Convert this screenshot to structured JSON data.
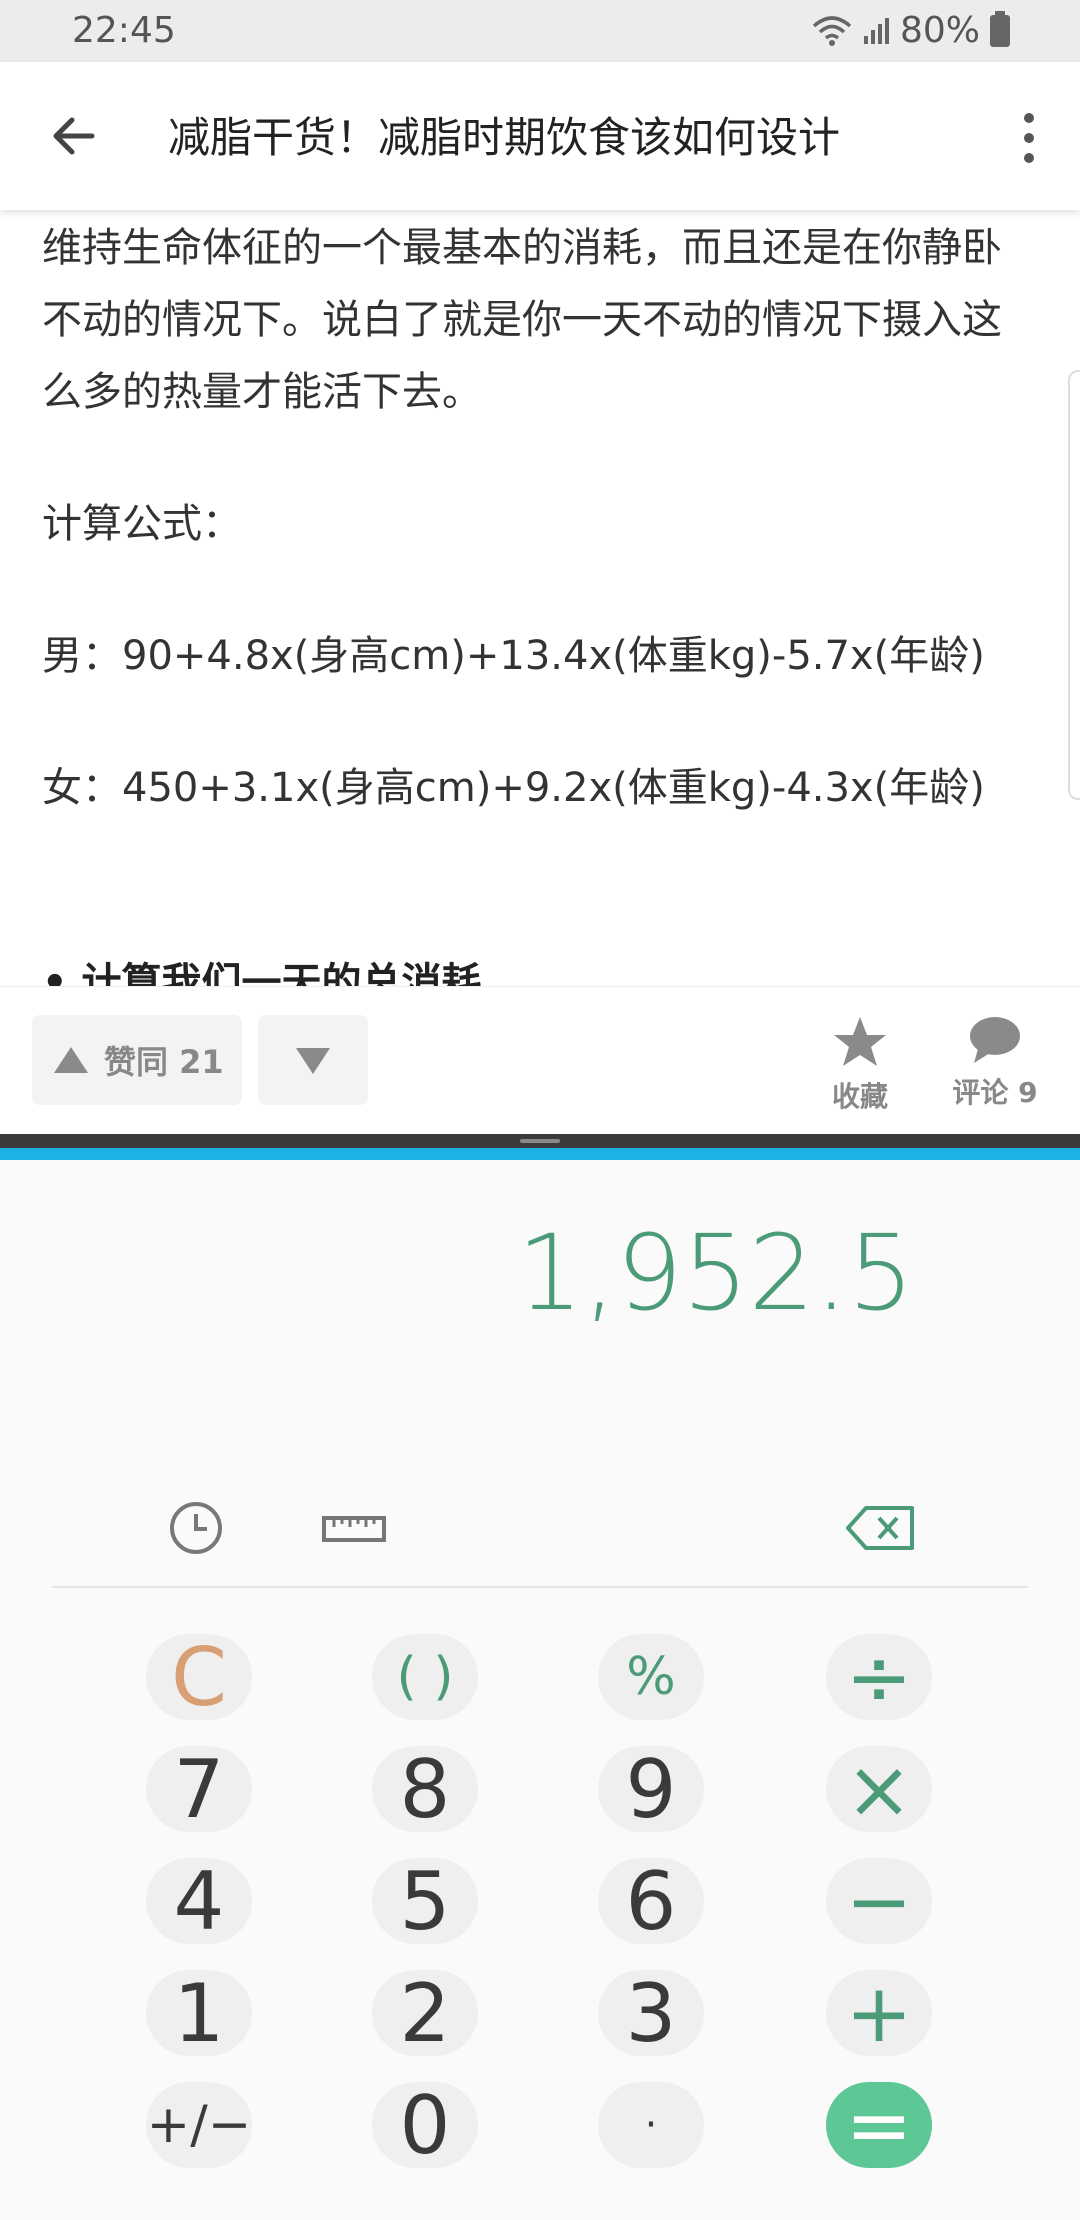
{
  "status": {
    "time": "22:45",
    "battery": "80%"
  },
  "appbar": {
    "title": "减脂干货！减脂时期饮食该如何设计"
  },
  "article": {
    "para1": "维持生命体征的一个最基本的消耗，而且还是在你静卧不动的情况下。说白了就是你一天不动的情况下摄入这么多的热量才能活下去。",
    "formula_label": "计算公式：",
    "male": "男：90+4.8x(身高cm)+13.4x(体重kg)-5.7x(年龄)",
    "female": "女：450+3.1x(身高cm)+9.2x(体重kg)-4.3x(年龄)",
    "bullet": "• 计算我们一天的总消耗"
  },
  "votebar": {
    "agree_label": "赞同 21",
    "favorite_label": "收藏",
    "comment_label": "评论 9"
  },
  "calculator": {
    "display": "1,952.5",
    "keys": {
      "clear": "C",
      "paren": "( )",
      "percent": "%",
      "divide": "÷",
      "k7": "7",
      "k8": "8",
      "k9": "9",
      "multiply": "×",
      "k4": "4",
      "k5": "5",
      "k6": "6",
      "minus": "−",
      "k1": "1",
      "k2": "2",
      "k3": "3",
      "plus": "+",
      "plusminus": "+/−",
      "k0": "0",
      "decimal": "·",
      "equals": "="
    }
  },
  "colors": {
    "accent": "#1eb1e7",
    "calc_green": "#4b9b79",
    "equals_bg": "#5dc795",
    "clear_orange": "#d99f74"
  }
}
